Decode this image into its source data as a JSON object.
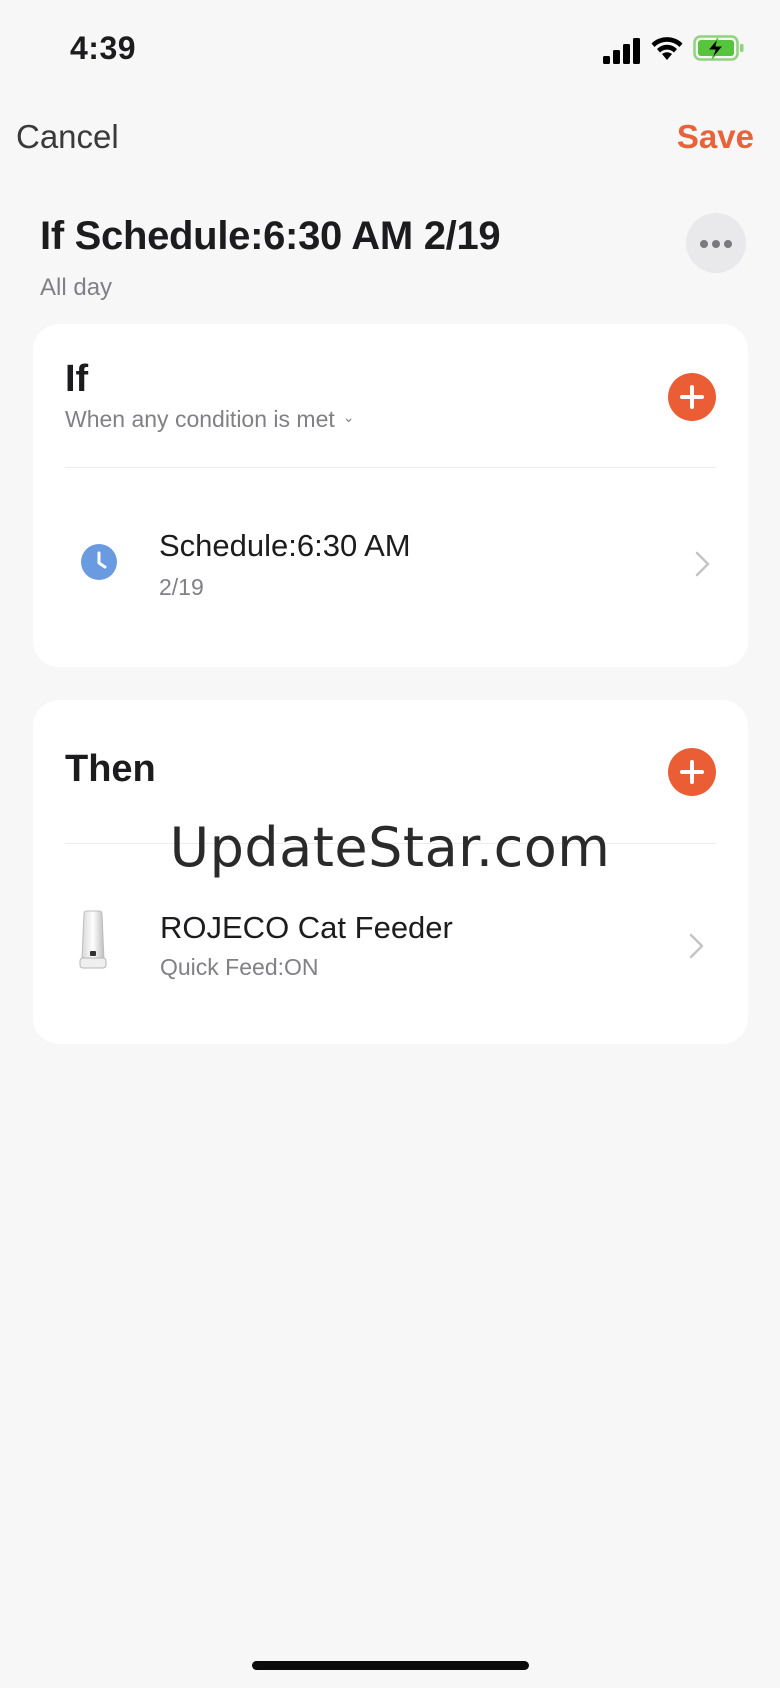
{
  "status_bar": {
    "time": "4:39"
  },
  "nav": {
    "cancel_label": "Cancel",
    "save_label": "Save"
  },
  "header": {
    "title": "If Schedule:6:30 AM 2/19",
    "subtitle": "All day"
  },
  "if_section": {
    "title": "If",
    "condition_mode": "When any condition is met",
    "items": [
      {
        "icon": "clock-icon",
        "title": "Schedule:6:30 AM",
        "subtitle": "2/19"
      }
    ]
  },
  "then_section": {
    "title": "Then",
    "items": [
      {
        "icon": "cat-feeder-icon",
        "title": "ROJECO Cat Feeder",
        "subtitle": "Quick Feed:ON"
      }
    ]
  },
  "watermark": "UpdateStar.com",
  "colors": {
    "accent": "#eb5d35",
    "save": "#e8633a",
    "clock": "#6a9be0",
    "background": "#f7f7f7"
  }
}
